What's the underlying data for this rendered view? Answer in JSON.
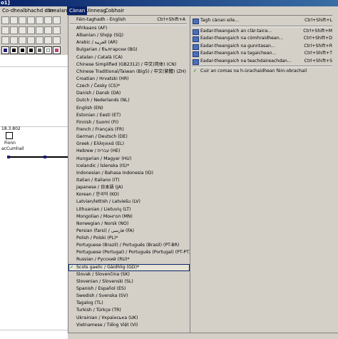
{
  "window": {
    "title": "o1]"
  },
  "menubar": {
    "items": [
      {
        "label": "Co-dhealbhachd clàr"
      },
      {
        "label": "Innealan"
      },
      {
        "label": "Cànan"
      },
      {
        "label": "Uinneag"
      },
      {
        "label": "Cobhair"
      }
    ]
  },
  "canvas": {
    "node_date": "18.3.802",
    "node_name_line1": "Fionn",
    "node_name_line2": "acCumhail"
  },
  "language_menu": {
    "items": [
      {
        "label": "Féin-taghadh - English",
        "shortcut": "Ctrl+Shift+A"
      },
      {
        "label": "Afrikaans (AF)"
      },
      {
        "label": "Albanian / Shqip (SQ)"
      },
      {
        "label": "Arabic / العربية (AR)"
      },
      {
        "label": "Bulgarian / български (BG)"
      },
      {
        "label": "Catalan / Català (CA)"
      },
      {
        "label": "Chinese Simplified (GB2312) / 中文(简体) (CN)"
      },
      {
        "label": "Chinese Traditional/Taiwan (Big5) / 中文(繁體) (ZH)"
      },
      {
        "label": "Croatian / Hrvatski (HR)"
      },
      {
        "label": "Czech / Česky (CS)*"
      },
      {
        "label": "Danish / Dansk (DA)"
      },
      {
        "label": "Dutch / Nederlands (NL)"
      },
      {
        "label": "English (EN)"
      },
      {
        "label": "Estonian / Eesti (ET)"
      },
      {
        "label": "Finnish / Suomi (FI)"
      },
      {
        "label": "French / Français (FR)"
      },
      {
        "label": "German / Deutsch (DE)"
      },
      {
        "label": "Greek / Ελληνικά (EL)"
      },
      {
        "label": "Hebrew / עברית (HE)"
      },
      {
        "label": "Hungarian / Magyar (HU)"
      },
      {
        "label": "Icelandic / Íslenska (IS)*"
      },
      {
        "label": "Indonesian / Bahasa Indonesia (ID)"
      },
      {
        "label": "Italian / Italiano (IT)"
      },
      {
        "label": "Japanese / 日本語 (JA)"
      },
      {
        "label": "Korean / 한국어 (KO)"
      },
      {
        "label": "Latvian/lettish / Latviešu (LV)"
      },
      {
        "label": "Lithuanian / Lietuvių (LT)"
      },
      {
        "label": "Mongolian / Монгол (MN)"
      },
      {
        "label": "Norwegian / Norsk (NO)"
      },
      {
        "label": "Persian (farsi) / فارسی (FA)"
      },
      {
        "label": "Polish / Polski (PL)*"
      },
      {
        "label": "Portuguese (Brazil) / Português (Brasil) (PT-BR)"
      },
      {
        "label": "Portuguese (Portugal) / Português (Portugal) (PT-PT)"
      },
      {
        "label": "Russian / Русский (RU)*"
      },
      {
        "label": "Scots gaelic / Gàidhlig (GD)*",
        "checked": true
      },
      {
        "label": "Slovak / Slovenčina (SK)"
      },
      {
        "label": "Slovenian / Slovenski (SL)"
      },
      {
        "label": "Spanish / Español (ES)"
      },
      {
        "label": "Swedish / Svenska (SV)"
      },
      {
        "label": "Tagalog (TL)"
      },
      {
        "label": "Turkish / Türkçe (TR)"
      },
      {
        "label": "Ukrainian / Українська (UK)"
      },
      {
        "label": "Vietnamese / Tiếng Việt (VI)"
      }
    ]
  },
  "submenu": {
    "items": [
      {
        "label": "Tagh cànan eile...",
        "shortcut": "Ctrl+Shift+L"
      },
      {
        "label": "Eadar-theangaich an clàr-taice...",
        "shortcut": "Ctrl+Shift+M"
      },
      {
        "label": "Eadar-theangaich na còmhraidhean...",
        "shortcut": "Ctrl+Shift+D"
      },
      {
        "label": "Eadar-theangaich na gunntasan...",
        "shortcut": "Ctrl+Shift+R"
      },
      {
        "label": "Eadar-theangaich na tagaichean...",
        "shortcut": "Ctrl+Shift+T"
      },
      {
        "label": "Eadar-theangaich na teachdaireachdan...",
        "shortcut": "Ctrl+Shift+S"
      },
      {
        "label": "Cuir an comas na h-ùrachaidhean fèin-obrachail",
        "checked": true
      }
    ]
  },
  "colors": {
    "accent": "#0a246a",
    "menu_bg": "#d4d0c8",
    "check": "#008000"
  }
}
